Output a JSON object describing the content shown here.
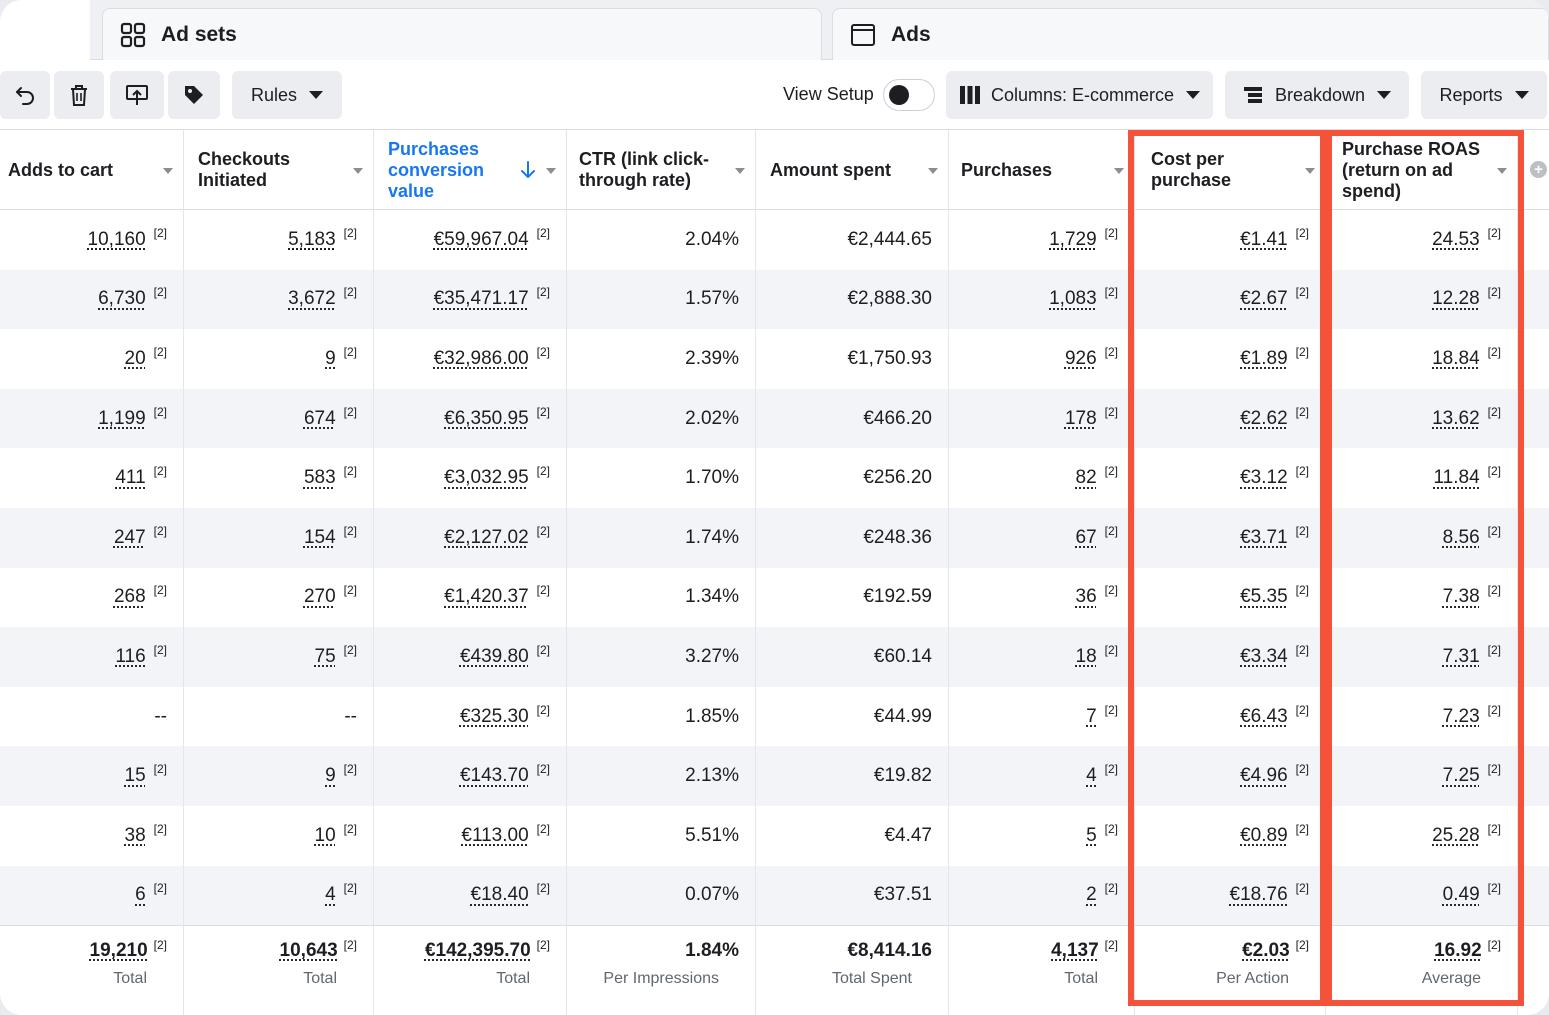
{
  "tabs": [
    {
      "label": "Ad sets",
      "icon": "grid-icon"
    },
    {
      "label": "Ads",
      "icon": "ad-window-icon"
    }
  ],
  "toolbar": {
    "rules_label": "Rules",
    "view_setup_label": "View Setup",
    "columns_label": "Columns: E-commerce",
    "breakdown_label": "Breakdown",
    "reports_label": "Reports"
  },
  "columns": [
    {
      "key": "adds_to_cart",
      "label": "Adds to cart"
    },
    {
      "key": "checkouts",
      "label": "Checkouts Initiated"
    },
    {
      "key": "conv_value",
      "label": "Purchases conversion value"
    },
    {
      "key": "ctr",
      "label": "CTR (link click-through rate)"
    },
    {
      "key": "spent",
      "label": "Amount spent"
    },
    {
      "key": "purchases",
      "label": "Purchases"
    },
    {
      "key": "cpp",
      "label": "Cost per purchase"
    },
    {
      "key": "roas",
      "label": "Purchase ROAS (return on ad spend)"
    }
  ],
  "footnote": "[2]",
  "rows": [
    {
      "adds_to_cart": "10,160",
      "checkouts": "5,183",
      "conv_value": "€59,967.04",
      "ctr": "2.04%",
      "spent": "€2,444.65",
      "purchases": "1,729",
      "cpp": "€1.41",
      "roas": "24.53"
    },
    {
      "adds_to_cart": "6,730",
      "checkouts": "3,672",
      "conv_value": "€35,471.17",
      "ctr": "1.57%",
      "spent": "€2,888.30",
      "purchases": "1,083",
      "cpp": "€2.67",
      "roas": "12.28"
    },
    {
      "adds_to_cart": "20",
      "checkouts": "9",
      "conv_value": "€32,986.00",
      "ctr": "2.39%",
      "spent": "€1,750.93",
      "purchases": "926",
      "cpp": "€1.89",
      "roas": "18.84"
    },
    {
      "adds_to_cart": "1,199",
      "checkouts": "674",
      "conv_value": "€6,350.95",
      "ctr": "2.02%",
      "spent": "€466.20",
      "purchases": "178",
      "cpp": "€2.62",
      "roas": "13.62"
    },
    {
      "adds_to_cart": "411",
      "checkouts": "583",
      "conv_value": "€3,032.95",
      "ctr": "1.70%",
      "spent": "€256.20",
      "purchases": "82",
      "cpp": "€3.12",
      "roas": "11.84"
    },
    {
      "adds_to_cart": "247",
      "checkouts": "154",
      "conv_value": "€2,127.02",
      "ctr": "1.74%",
      "spent": "€248.36",
      "purchases": "67",
      "cpp": "€3.71",
      "roas": "8.56"
    },
    {
      "adds_to_cart": "268",
      "checkouts": "270",
      "conv_value": "€1,420.37",
      "ctr": "1.34%",
      "spent": "€192.59",
      "purchases": "36",
      "cpp": "€5.35",
      "roas": "7.38"
    },
    {
      "adds_to_cart": "116",
      "checkouts": "75",
      "conv_value": "€439.80",
      "ctr": "3.27%",
      "spent": "€60.14",
      "purchases": "18",
      "cpp": "€3.34",
      "roas": "7.31"
    },
    {
      "adds_to_cart": "--",
      "checkouts": "--",
      "conv_value": "€325.30",
      "ctr": "1.85%",
      "spent": "€44.99",
      "purchases": "7",
      "cpp": "€6.43",
      "roas": "7.23"
    },
    {
      "adds_to_cart": "15",
      "checkouts": "9",
      "conv_value": "€143.70",
      "ctr": "2.13%",
      "spent": "€19.82",
      "purchases": "4",
      "cpp": "€4.96",
      "roas": "7.25"
    },
    {
      "adds_to_cart": "38",
      "checkouts": "10",
      "conv_value": "€113.00",
      "ctr": "5.51%",
      "spent": "€4.47",
      "purchases": "5",
      "cpp": "€0.89",
      "roas": "25.28"
    },
    {
      "adds_to_cart": "6",
      "checkouts": "4",
      "conv_value": "€18.40",
      "ctr": "0.07%",
      "spent": "€37.51",
      "purchases": "2",
      "cpp": "€18.76",
      "roas": "0.49"
    }
  ],
  "totals": [
    {
      "value": "19,210",
      "label": "Total"
    },
    {
      "value": "10,643",
      "label": "Total"
    },
    {
      "value": "€142,395.70",
      "label": "Total"
    },
    {
      "value": "1.84%",
      "label": "Per Impressions"
    },
    {
      "value": "€8,414.16",
      "label": "Total Spent"
    },
    {
      "value": "4,137",
      "label": "Total"
    },
    {
      "value": "€2.03",
      "label": "Per Action"
    },
    {
      "value": "16.92",
      "label": "Average"
    }
  ],
  "highlight_color": "#f4533a",
  "sort_color": "#1877f2"
}
